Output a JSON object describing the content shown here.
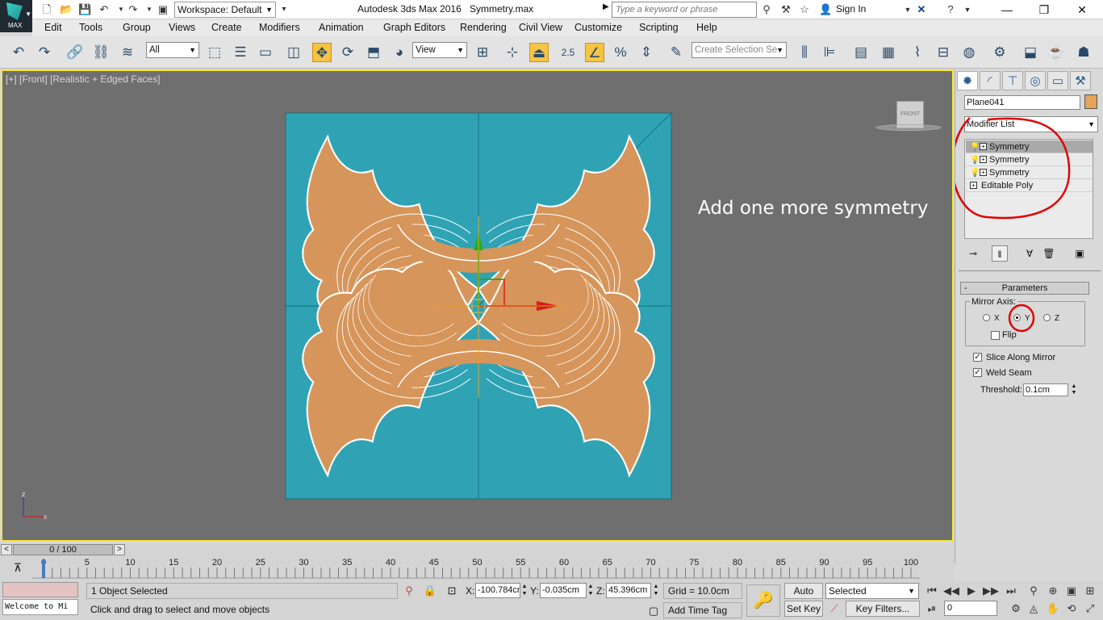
{
  "titlebar": {
    "logo_text": "MAX",
    "workspace": "Workspace: Default",
    "app_title": "Autodesk 3ds Max 2016",
    "file_title": "Symmetry.max",
    "search_placeholder": "Type a keyword or phrase",
    "sign_in": "Sign In"
  },
  "menu": [
    "Edit",
    "Tools",
    "Group",
    "Views",
    "Create",
    "Modifiers",
    "Animation",
    "Graph Editors",
    "Rendering",
    "Civil View",
    "Customize",
    "Scripting",
    "Help"
  ],
  "toolbar": {
    "filter": "All",
    "ref_coord": "View",
    "angle_snap": "2.5",
    "selection_set_placeholder": "Create Selection Se"
  },
  "viewport": {
    "label": "[+] [Front] [Realistic + Edged Faces]",
    "annotation": "Add one more symmetry",
    "viewcube_label": "FRONT",
    "axis_z": "z",
    "axis_x": "x",
    "bg_color": "#6f6f6f",
    "plane_color": "#2fa3b4",
    "mesh_color": "#d6955a"
  },
  "command_panel": {
    "object_name": "Plane041",
    "modifier_list": "Modifier List",
    "stack": [
      {
        "label": "Symmetry",
        "selected": true
      },
      {
        "label": "Symmetry",
        "selected": false
      },
      {
        "label": "Symmetry",
        "selected": false
      },
      {
        "label": "Editable Poly",
        "selected": false
      }
    ],
    "rollout_title": "Parameters",
    "mirror_axis_label": "Mirror Axis:",
    "axis_x": "X",
    "axis_y": "Y",
    "axis_z": "Z",
    "selected_axis": "Y",
    "flip": "Flip",
    "slice_along_mirror": "Slice Along Mirror",
    "weld_seam": "Weld Seam",
    "threshold_label": "Threshold:",
    "threshold_value": "0.1cm"
  },
  "timeline": {
    "slider_text": "0 / 100",
    "ticks": [
      "0",
      "5",
      "10",
      "15",
      "20",
      "25",
      "30",
      "35",
      "40",
      "45",
      "50",
      "55",
      "60",
      "65",
      "70",
      "75",
      "80",
      "85",
      "90",
      "95",
      "100"
    ]
  },
  "status": {
    "listener_text": "Welcome to Mi",
    "selection": "1 Object Selected",
    "prompt": "Click and drag to select and move objects",
    "x_label": "X:",
    "x_value": "-100.784cm",
    "y_label": "Y:",
    "y_value": "-0.035cm",
    "z_label": "Z:",
    "z_value": "45.396cm",
    "grid": "Grid = 10.0cm",
    "add_time_tag": "Add Time Tag",
    "auto_key": "Auto Key",
    "set_key": "Set Key",
    "key_mode": "Selected",
    "key_filters": "Key Filters...",
    "frame": "0"
  }
}
